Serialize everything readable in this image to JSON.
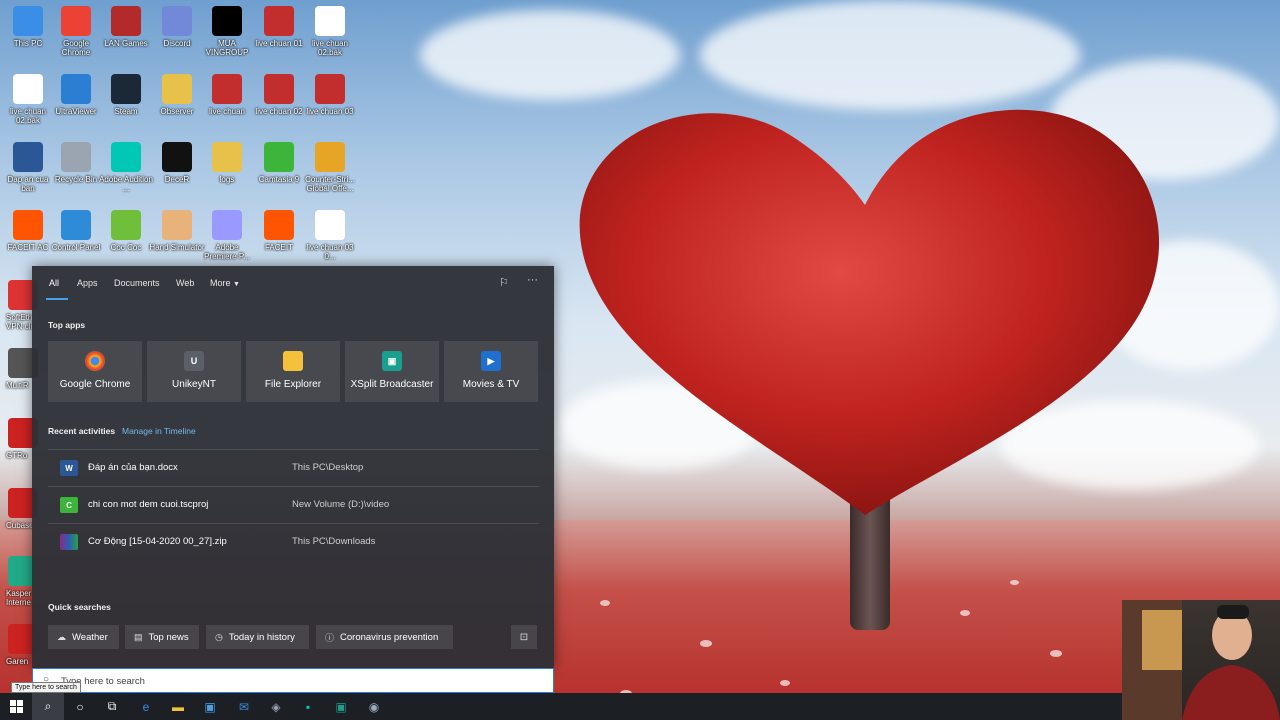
{
  "desktop": {
    "icons": [
      {
        "label": "This PC",
        "icon": "this-pc-icon",
        "color": "#3a8ee6"
      },
      {
        "label": "Google Chrome",
        "icon": "chrome-icon",
        "color": "#ea4335"
      },
      {
        "label": "LAN Games",
        "icon": "lan-games-icon",
        "color": "#b32a2a"
      },
      {
        "label": "Discord",
        "icon": "discord-icon",
        "color": "#7289da"
      },
      {
        "label": "MUA VINGROUP",
        "icon": "black-image-icon",
        "color": "#000000"
      },
      {
        "label": "live chuan 01",
        "icon": "cubase-file-icon",
        "color": "#c22d2d"
      },
      {
        "label": "live chuan 02.bak",
        "icon": "blank-file-icon",
        "color": "#ffffff"
      },
      {
        "label": "live chuan 02.bak",
        "icon": "blank-file-icon",
        "color": "#ffffff"
      },
      {
        "label": "UltraViewer",
        "icon": "ultraviewer-icon",
        "color": "#2b7fd3"
      },
      {
        "label": "Steam",
        "icon": "steam-icon",
        "color": "#1b2838"
      },
      {
        "label": "Observer",
        "icon": "folder-icon",
        "color": "#e8c14a"
      },
      {
        "label": "live chuan",
        "icon": "cubase-file-icon",
        "color": "#c22d2d"
      },
      {
        "label": "live chuan 02",
        "icon": "cubase-file-icon",
        "color": "#c22d2d"
      },
      {
        "label": "live chuan 03",
        "icon": "cubase-file-icon",
        "color": "#c22d2d"
      },
      {
        "label": "Dap an cua ban",
        "icon": "word-icon",
        "color": "#2b5797"
      },
      {
        "label": "Recycle Bin",
        "icon": "recycle-bin-icon",
        "color": "#9aa5b1"
      },
      {
        "label": "Adobe Audition ...",
        "icon": "audition-icon",
        "color": "#00c8b4"
      },
      {
        "label": "DeceR",
        "icon": "rabbit-icon",
        "color": "#111111"
      },
      {
        "label": "logs",
        "icon": "folder-icon",
        "color": "#e8c14a"
      },
      {
        "label": "Camtasia 9",
        "icon": "camtasia-icon",
        "color": "#3db53b"
      },
      {
        "label": "Counter-Stri... Global Offe...",
        "icon": "csgo-icon",
        "color": "#e6a524"
      },
      {
        "label": "FACEIT AC",
        "icon": "faceit-ac-icon",
        "color": "#ff5500"
      },
      {
        "label": "Control Panel",
        "icon": "control-panel-icon",
        "color": "#2e8bd8"
      },
      {
        "label": "Coc Coc",
        "icon": "coccoc-icon",
        "color": "#6fbf3a"
      },
      {
        "label": "Hand Simulator",
        "icon": "hand-icon",
        "color": "#e8b37a"
      },
      {
        "label": "Adobe Premiere P...",
        "icon": "premiere-icon",
        "color": "#9999ff"
      },
      {
        "label": "FACEIT",
        "icon": "faceit-icon",
        "color": "#ff5500"
      },
      {
        "label": "live chuan 03 0...",
        "icon": "blank-file-icon",
        "color": "#ffffff"
      }
    ],
    "left_partial": [
      "SoftEth VPN cli",
      "MultiR",
      "GTRo",
      "Cubase",
      "Kasper Interne",
      "Garen"
    ]
  },
  "search_panel": {
    "tabs": [
      {
        "label": "All",
        "active": true
      },
      {
        "label": "Apps"
      },
      {
        "label": "Documents"
      },
      {
        "label": "Web"
      },
      {
        "label": "More"
      }
    ],
    "top_apps_title": "Top apps",
    "top_apps": [
      {
        "label": "Google Chrome",
        "icon": "chrome-icon"
      },
      {
        "label": "UnikeyNT",
        "icon": "unikey-icon"
      },
      {
        "label": "File Explorer",
        "icon": "file-explorer-icon"
      },
      {
        "label": "XSplit Broadcaster",
        "icon": "xsplit-icon"
      },
      {
        "label": "Movies & TV",
        "icon": "movies-tv-icon"
      }
    ],
    "recent_title": "Recent activities",
    "timeline_link": "Manage in Timeline",
    "recent": [
      {
        "name": "Đáp án của bạn.docx",
        "location": "This PC\\Desktop",
        "icon": "word-icon"
      },
      {
        "name": "chi con mot dem cuoi.tscproj",
        "location": "New Volume (D:)\\video",
        "icon": "camtasia-icon"
      },
      {
        "name": "Cơ Động [15-04-2020 00_27].zip",
        "location": "This PC\\Downloads",
        "icon": "winrar-icon"
      }
    ],
    "quick_title": "Quick searches",
    "quick": [
      {
        "label": "Weather",
        "icon": "weather-icon"
      },
      {
        "label": "Top news",
        "icon": "news-icon"
      },
      {
        "label": "Today in history",
        "icon": "clock-icon"
      },
      {
        "label": "Coronavirus prevention",
        "icon": "info-icon"
      }
    ]
  },
  "search_box": {
    "placeholder": "Type here to search",
    "tooltip": "Type here to search"
  },
  "taskbar": {
    "items": [
      "windows-start-icon",
      "search-icon",
      "cortana-icon",
      "task-view-icon",
      "edge-icon",
      "file-explorer-icon",
      "store-icon",
      "mail-icon",
      "game-icon",
      "audition-icon",
      "xsplit-icon",
      "steam-icon"
    ]
  },
  "colors": {
    "accent": "#4aa0e6",
    "panel": "#2e3036",
    "link": "#78b7ef"
  }
}
